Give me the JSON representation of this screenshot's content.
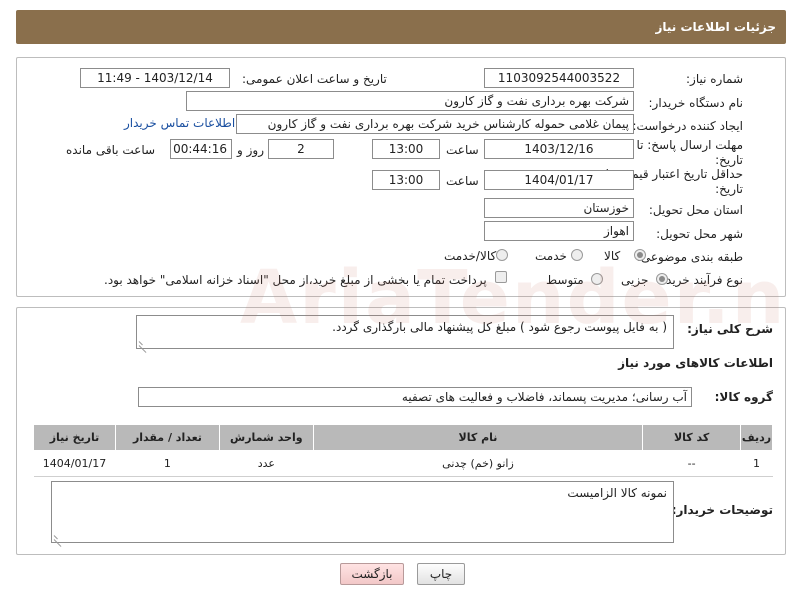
{
  "header": {
    "title": "جزئیات اطلاعات نیاز"
  },
  "info": {
    "need_number_label": "شماره نیاز:",
    "need_number": "1103092544003522",
    "announce_label": "تاریخ و ساعت اعلان عمومی:",
    "announce_value": "1403/12/14 - 11:49",
    "buyer_org_label": "نام دستگاه خریدار:",
    "buyer_org": "شرکت بهره برداری نفت و گاز کارون",
    "creator_label": "ایجاد کننده درخواست:",
    "creator": "پیمان غلامی حموله کارشناس خرید شرکت بهره برداری نفت و گاز کارون",
    "contact_link": "اطلاعات تماس خریدار",
    "deadline_label_1": "مهلت ارسال پاسخ: تا",
    "deadline_label_2": "تاریخ:",
    "deadline_date": "1403/12/16",
    "time_label": "ساعت",
    "deadline_time": "13:00",
    "days_value": "2",
    "days_label": "روز و",
    "remaining_time": "00:44:16",
    "remaining_label": "ساعت باقی مانده",
    "price_valid_label_1": "حداقل تاریخ اعتبار قیمت: تا",
    "price_valid_label_2": "تاریخ:",
    "price_valid_date": "1404/01/17",
    "price_valid_time": "13:00",
    "province_label": "استان محل تحویل:",
    "province": "خوزستان",
    "city_label": "شهر محل تحویل:",
    "city": "اهواز",
    "category_label": "طبقه بندی موضوعی:",
    "category_options": [
      "کالا",
      "خدمت",
      "کالا/خدمت"
    ],
    "category_selected": "کالا",
    "process_label": "نوع فرآیند خرید :",
    "process_options": [
      "جزیی",
      "متوسط"
    ],
    "process_selected": "جزیی",
    "payment_note": "پرداخت تمام یا بخشی از مبلغ خرید،از محل \"اسناد خزانه اسلامی\" خواهد بود."
  },
  "details": {
    "description_label": "شرح کلی نیاز:",
    "description": "( به فایل پیوست رجوع شود ) مبلغ کل پیشنهاد مالی بارگذاری گردد.",
    "goods_info_title": "اطلاعات کالاهای مورد نیاز",
    "goods_group_label": "گروه کالا:",
    "goods_group": "آب رسانی؛ مدیریت پسماند، فاضلاب و فعالیت های تصفیه",
    "table": {
      "headers": [
        "ردیف",
        "کد کالا",
        "نام کالا",
        "واحد شمارش",
        "تعداد / مقدار",
        "تاریخ نیاز"
      ],
      "rows": [
        [
          "1",
          "--",
          "زانو (خم) چدنی",
          "عدد",
          "1",
          "1404/01/17"
        ]
      ]
    },
    "buyer_notes_label": "توضیحات خریدار:",
    "buyer_notes": "نمونه کالا الزامیست"
  },
  "buttons": {
    "print": "چاپ",
    "back": "بازگشت"
  },
  "watermark_text": "AriaTender.net"
}
